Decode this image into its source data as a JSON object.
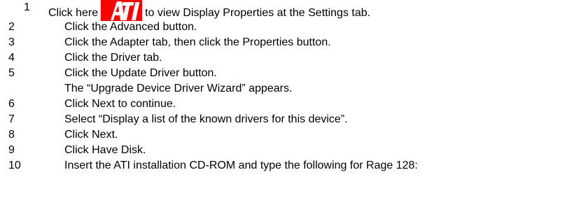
{
  "steps": [
    {
      "num": "1",
      "before": "Click here",
      "after": "to view Display Properties at the Settings tab.",
      "icon": "ati-logo-icon"
    },
    {
      "num": "2",
      "text": "Click the Advanced button."
    },
    {
      "num": "3",
      "text": "Click the Adapter tab, then click the Properties button."
    },
    {
      "num": "4",
      "text": "Click the Driver tab."
    },
    {
      "num": "5",
      "text": "Click the Update Driver button."
    },
    {
      "num": "",
      "text": "The “Upgrade Device Driver Wizard” appears."
    },
    {
      "num": "6",
      "text": "Click Next to continue."
    },
    {
      "num": "7",
      "text": "Select “Display a list of the known drivers for this device”."
    },
    {
      "num": "8",
      "text": "Click Next."
    },
    {
      "num": "9",
      "text": "Click Have Disk."
    },
    {
      "num": "10",
      "text": "Insert the ATI installation CD-ROM and type the following for Rage 128:"
    }
  ],
  "colors": {
    "logo_red": "#ff0000",
    "text": "#000000",
    "background": "#ffffff"
  }
}
